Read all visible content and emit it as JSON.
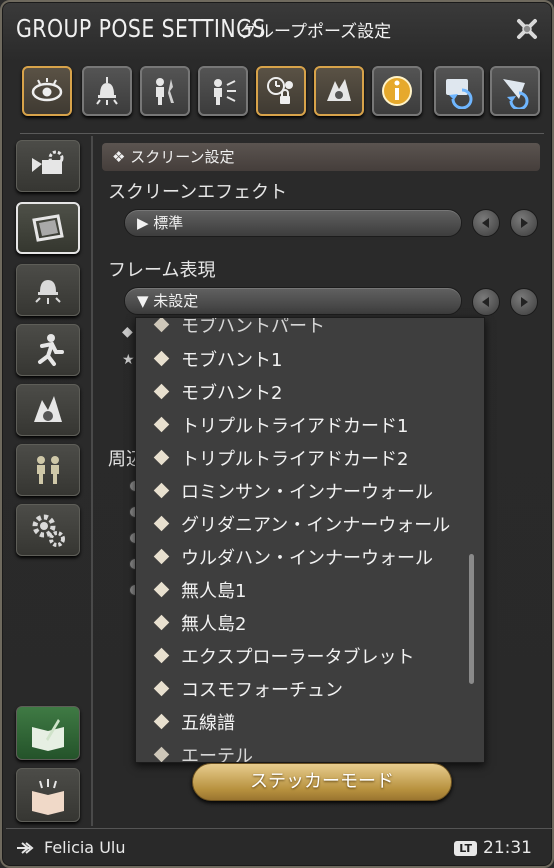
{
  "window": {
    "title": "GROUP POSE SETTINGS",
    "subtitle": "グループポーズ設定"
  },
  "toolbar": {
    "buttons": [
      {
        "icon": "eye-icon",
        "active": true
      },
      {
        "icon": "lamp-icon",
        "active": false
      },
      {
        "icon": "character-stand-icon",
        "active": false
      },
      {
        "icon": "character-light-icon",
        "active": false
      },
      {
        "icon": "clock-sun-icon",
        "active": true
      },
      {
        "icon": "effect-icon",
        "active": true
      },
      {
        "icon": "info-icon",
        "active": false
      },
      {
        "icon": "undo-camera-icon",
        "active": false
      },
      {
        "icon": "undo-rotate-icon",
        "active": false
      }
    ]
  },
  "sidebar": {
    "items": [
      {
        "icon": "camera-settings-icon",
        "active": false
      },
      {
        "icon": "screen-frame-icon",
        "active": true
      },
      {
        "icon": "lamp-icon",
        "active": false
      },
      {
        "icon": "running-figure-icon",
        "active": false
      },
      {
        "icon": "effect-icon",
        "active": false
      },
      {
        "icon": "two-characters-icon",
        "active": false
      },
      {
        "icon": "gears-icon",
        "active": false
      }
    ]
  },
  "screen_settings": {
    "header": "❖ スクリーン設定",
    "screen_effect_label": "スクリーンエフェクト",
    "screen_effect_value": "▶ 標準",
    "frame_label": "フレーム表現",
    "frame_value": "▼ 未設定",
    "partial_label": "周辺"
  },
  "frame_dropdown": {
    "top_cut": "モブハントパート",
    "items": [
      "モブハント1",
      "モブハント2",
      "トリプルトライアドカード1",
      "トリプルトライアドカード2",
      "ロミンサン・インナーウォール",
      "グリダニアン・インナーウォール",
      "ウルダハン・インナーウォール",
      "無人島1",
      "無人島2",
      "エクスプローラータブレット",
      "コスモフォーチュン",
      "五線譜"
    ],
    "bottom_cut": "エーテル"
  },
  "sticker_button": "ステッカーモード",
  "footer": {
    "player_name": "Felicia Ulu",
    "badge": "LT",
    "time": "21:31"
  },
  "colors": {
    "accent_gold": "#d8a34a",
    "sticker_gold": "#c9a04f",
    "diamond": "#e8e0cf"
  }
}
